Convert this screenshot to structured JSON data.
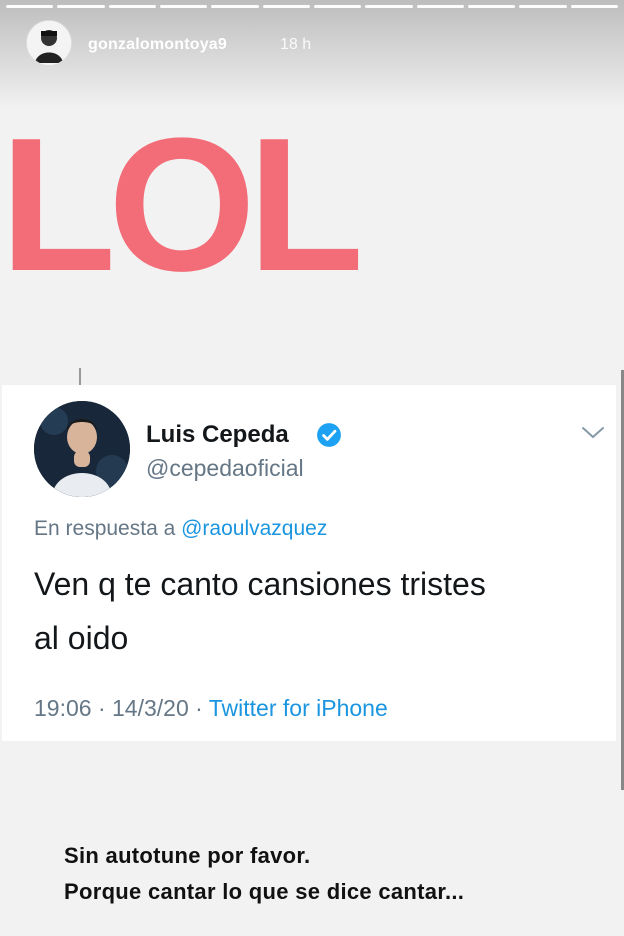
{
  "story": {
    "progress_segments": 12,
    "username": "gonzalomontoya9",
    "time_ago": "18 h",
    "overlay_text": "LOL",
    "caption_lines": [
      "Sin autotune por favor.",
      "Porque cantar lo que se dice cantar..."
    ]
  },
  "tweet": {
    "display_name": "Luis Cepeda",
    "handle": "@cepedaoficial",
    "reply_prefix": "En respuesta a",
    "reply_mention": "@raoulvazquez",
    "text_line1": "Ven q te canto cansiones tristes",
    "text_line2": "al oido",
    "time": "19:06 · 14/3/20 ·",
    "source": "Twitter for iPhone"
  },
  "colors": {
    "lol": "#f36d79",
    "twitter_blue": "#1b95e0",
    "muted": "#657786"
  }
}
